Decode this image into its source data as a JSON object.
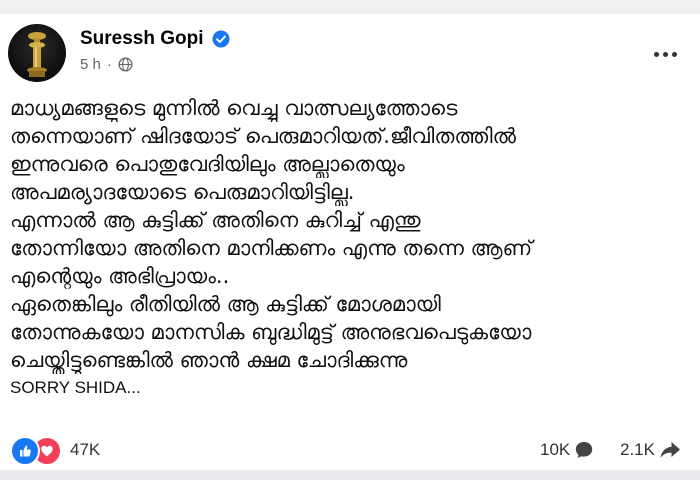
{
  "post": {
    "author": "Suressh Gopi",
    "time": "5 h",
    "time_sep": "·",
    "body_lines": [
      "മാധ്യമങ്ങളുടെ മുന്നിൽ വെച്ചു വാത്സല്യത്തോടെ",
      "തന്നെയാണ് ഷിദയോട് പെരുമാറിയത്.ജീവിതത്തിൽ",
      "ഇന്നുവരെ പൊതുവേദിയിലും അല്ലാതെയും",
      "അപമര്യാദയോടെ പെരുമാറിയിട്ടില്ല.",
      " എന്നാൽ ആ കുട്ടിക്ക് അതിനെ കുറിച്ച് എന്തു",
      "തോന്നിയോ അതിനെ മാനിക്കണം എന്നു തന്നെ ആണ്",
      "എന്റെയും അഭിപ്രായം..",
      "ഏതെങ്കിലും രീതിയിൽ ആ കുട്ടിക്ക് മോശമായി",
      "തോന്നുകയോ മാനസിക ബുദ്ധിമുട്ട് അനുഭവപെടുകയോ",
      "ചെയ്തിട്ടുണ്ടെങ്കിൽ ഞാൻ ക്ഷമ ചോദിക്കുന്നു",
      "SORRY SHIDA..."
    ]
  },
  "stats": {
    "reactions": "47K",
    "comments": "10K",
    "shares": "2.1K"
  },
  "icons": {
    "avatar": "lamp-emblem-avatar",
    "verified": "verified-badge-icon",
    "privacy": "globe-icon",
    "more": "more-options-icon",
    "like": "like-icon",
    "love": "love-icon",
    "comment": "comment-icon",
    "share": "share-icon"
  },
  "colors": {
    "verified": "#1877f2",
    "like": "#1877f2",
    "love": "#f33e58",
    "secondary_text": "#65676b"
  }
}
